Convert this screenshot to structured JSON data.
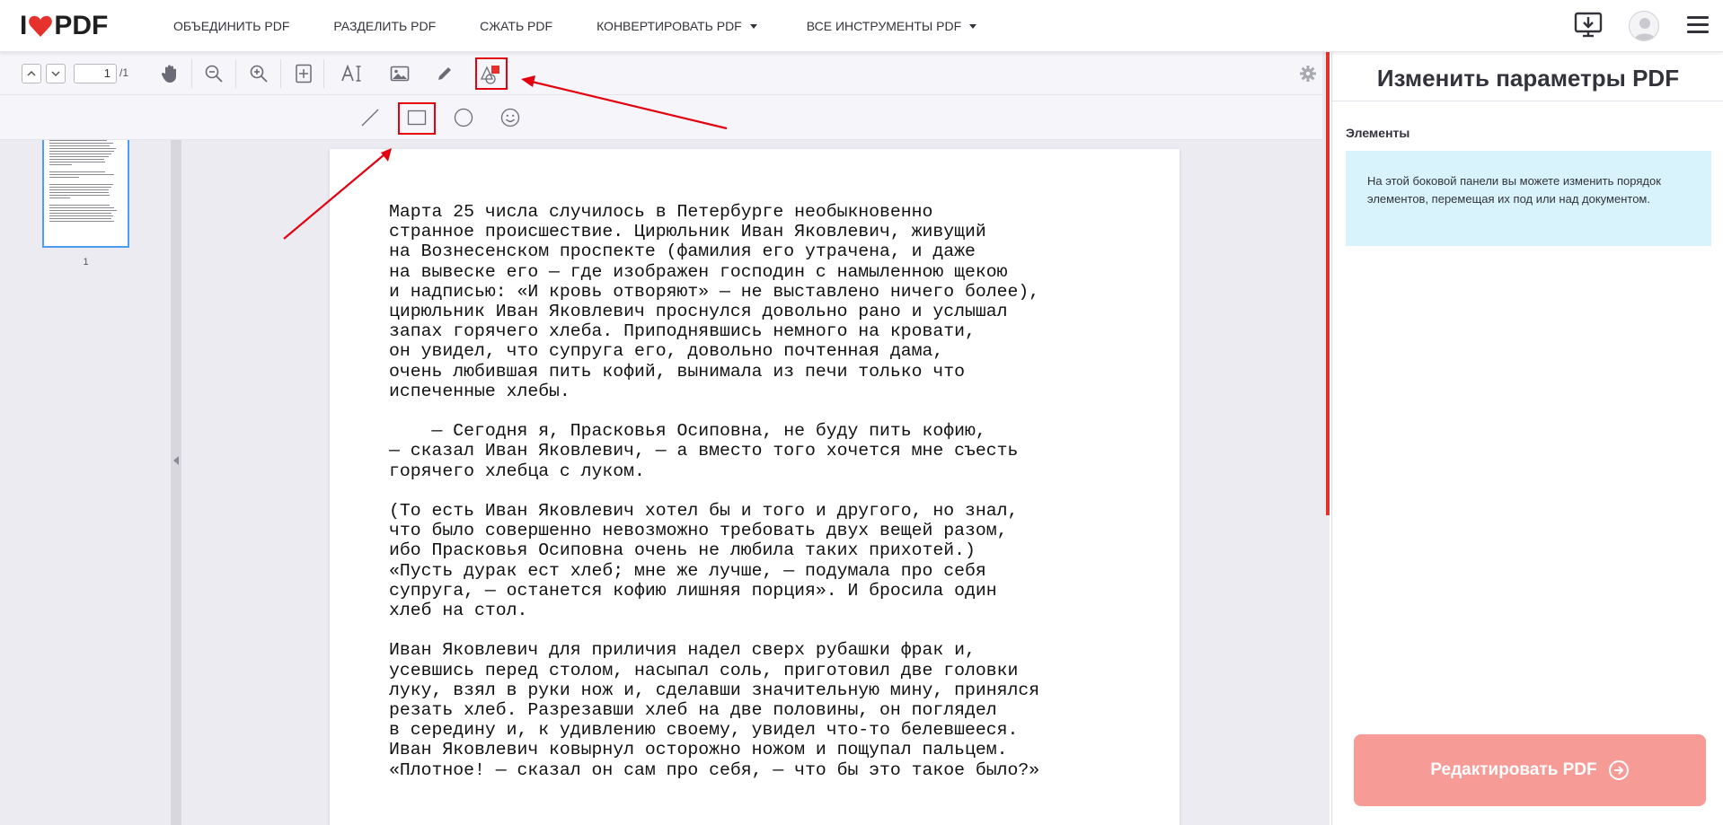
{
  "app": {
    "logo_left": "I",
    "logo_right": "PDF",
    "brand_color": "#e5322d"
  },
  "nav": {
    "items": [
      {
        "label": "ОБЪЕДИНИТЬ PDF"
      },
      {
        "label": "РАЗДЕЛИТЬ PDF"
      },
      {
        "label": "СЖАТЬ PDF"
      },
      {
        "label": "КОНВЕРТИРОВАТЬ PDF"
      },
      {
        "label": "ВСЕ ИНСТРУМЕНТЫ PDF"
      }
    ],
    "icons": [
      "download-desktop-icon",
      "user-avatar-icon",
      "hamburger-menu-icon"
    ]
  },
  "toolbar": {
    "page_current": "1",
    "page_total": "/1",
    "tools": [
      "chevron-up-icon",
      "chevron-down-icon",
      "hand-icon",
      "zoom-out-icon",
      "zoom-in-icon",
      "fit-page-icon",
      "text-icon",
      "image-icon",
      "pencil-icon",
      "shapes-icon",
      "settings-icon"
    ],
    "shape_tools": [
      "line-icon",
      "rectangle-icon",
      "ellipse-icon",
      "smiley-icon"
    ]
  },
  "thumbnails": {
    "pages": [
      {
        "label": "1"
      }
    ]
  },
  "document": {
    "text": "Марта 25 числа случилось в Петербурге необыкновенно\nстранное происшествие. Цирюльник Иван Яковлевич, живущий\nна Вознесенском проспекте (фамилия его утрачена, и даже\nна вывеске его — где изображен господин с намыленною щекою\nи надписью: «И кровь отворяют» — не выставлено ничего более),\nцирюльник Иван Яковлевич проснулся довольно рано и услышал\nзапах горячего хлеба. Приподнявшись немного на кровати,\nон увидел, что супруга его, довольно почтенная дама,\nочень любившая пить кофий, вынимала из печи только что\nиспеченные хлебы.\n\n    — Сегодня я, Прасковья Осиповна, не буду пить кофию,\n— сказал Иван Яковлевич, — а вместо того хочется мне съесть\nгорячего хлебца с луком.\n\n(То есть Иван Яковлевич хотел бы и того и другого, но знал,\nчто было совершенно невозможно требовать двух вещей разом,\nибо Прасковья Осиповна очень не любила таких прихотей.)\n«Пусть дурак ест хлеб; мне же лучше, — подумала про себя\nсупруга, — останется кофию лишняя порция». И бросила один\nхлеб на стол.\n\nИван Яковлевич для приличия надел сверх рубашки фрак и,\nусевшись перед столом, насыпал соль, приготовил две головки\nлуку, взял в руки нож и, сделавши значительную мину, принялся\nрезать хлеб. Разрезавши хлеб на две половины, он поглядел\nв середину и, к удивлению своему, увидел что-то белевшееся.\nИван Яковлевич ковырнул осторожно ножом и пощупал пальцем.\n«Плотное! — сказал он сам про себя, — что бы это такое было?»"
  },
  "sidebar": {
    "title": "Изменить параметры PDF",
    "section_title": "Элементы",
    "info_text": "На этой боковой панели вы можете изменить порядок элементов, перемещая их под или над документом.",
    "action_label": "Редактировать PDF",
    "info_bg": "#d8f3fb",
    "button_bg": "#f79b97"
  },
  "annotations": {
    "color": "#e3000f"
  }
}
